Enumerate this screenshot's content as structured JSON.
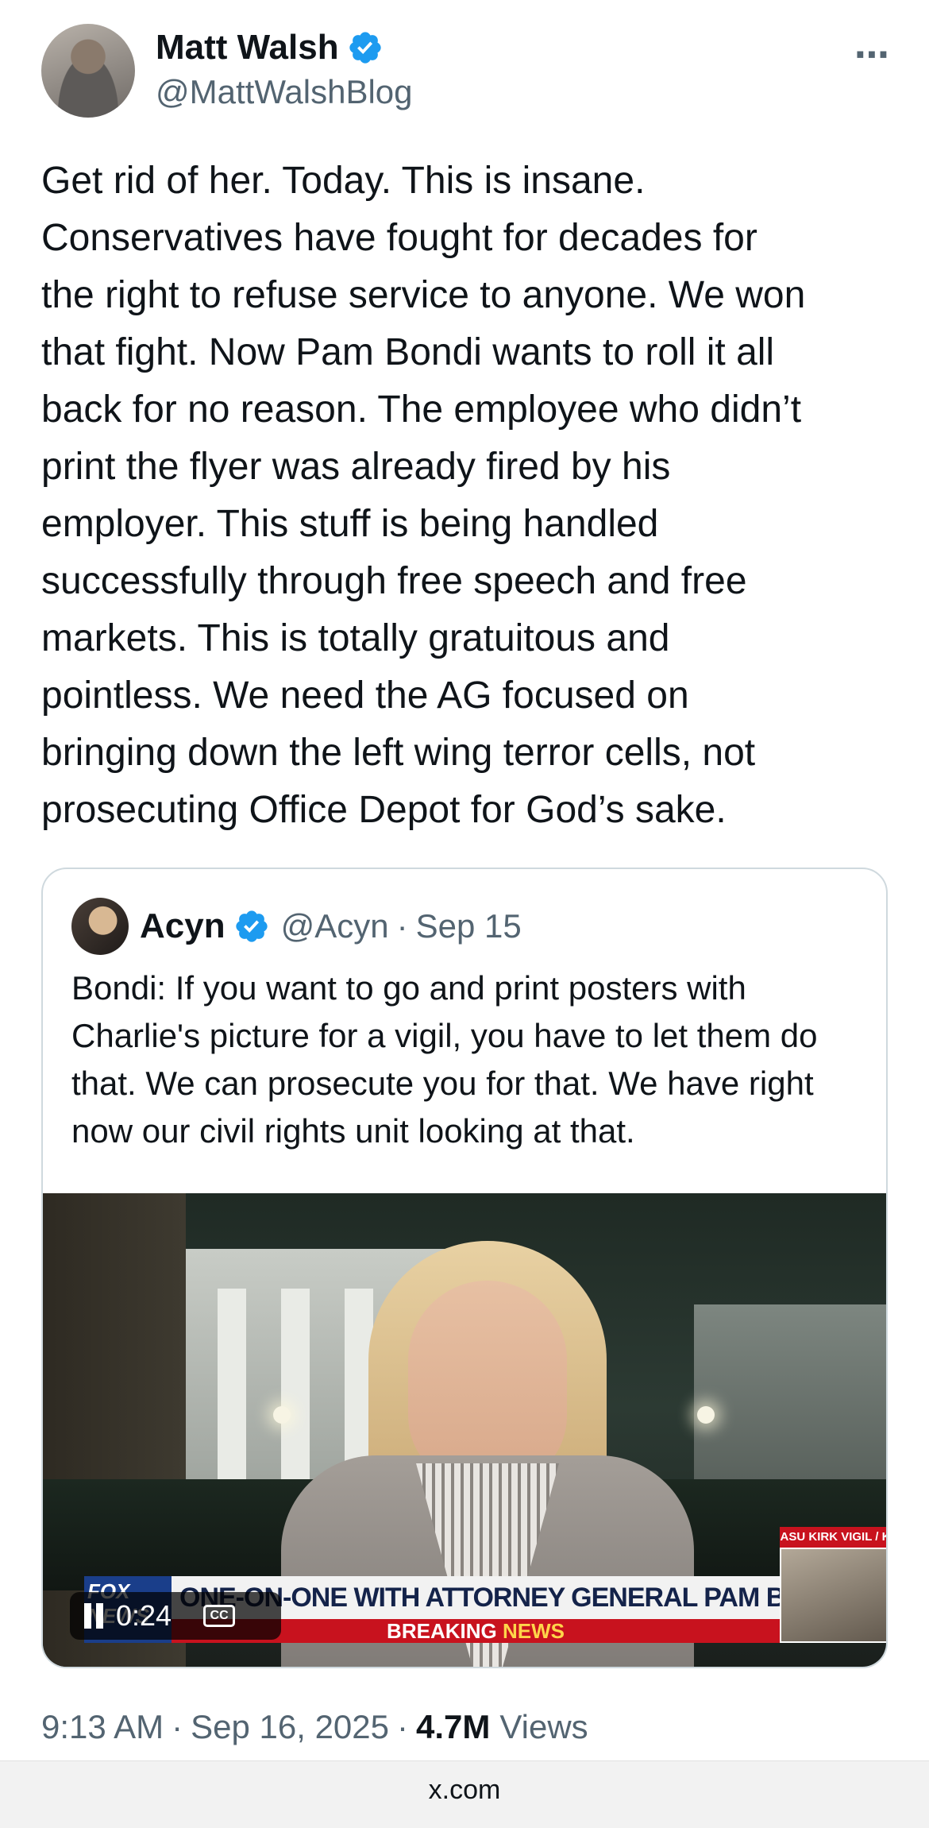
{
  "author": {
    "display_name": "Matt Walsh",
    "handle": "@MattWalshBlog",
    "verified": true,
    "more_icon": "⋯"
  },
  "tweet": {
    "text": "Get rid of her. Today. This is insane.\nConservatives have fought for decades for\nthe right to refuse service to anyone. We won\nthat fight. Now Pam Bondi wants to roll it all\nback for no reason. The employee who didn’t\nprint the flyer was already fired by his\nemployer. This stuff is being handled\nsuccessfully through free speech and free\nmarkets. This is totally gratuitous and\npointless. We need the AG focused on\nbringing down the left wing terror cells, not\nprosecuting Office Depot for God’s sake."
  },
  "quoted": {
    "display_name": "Acyn",
    "handle": "@Acyn",
    "separator": "·",
    "date": "Sep 15",
    "verified": true,
    "text": "Bondi: If you want to go and print posters with Charlie's picture for a vigil, you have to let them do that. We can prosecute you for that. We have right now our civil rights unit looking at that.",
    "video": {
      "time": "0:24",
      "cc_label": "CC",
      "chyron_title": "ONE-ON-ONE WITH ATTORNEY GENERAL PAM BONDI",
      "chyron_breaking": "BREAKING",
      "chyron_news": "NEWS",
      "inset_label": "ASU KIRK VIGIL / KSAZ",
      "network_logo": "FOX NEWS"
    }
  },
  "meta": {
    "time": "9:13 AM",
    "separator": "·",
    "date": "Sep 16, 2025",
    "views_count": "4.7M",
    "views_label": "Views"
  },
  "browser": {
    "url": "x.com"
  },
  "colors": {
    "verified_blue": "#1d9bf0",
    "secondary_text": "#536471",
    "primary_text": "#0f1419",
    "border": "#cfd9de"
  }
}
